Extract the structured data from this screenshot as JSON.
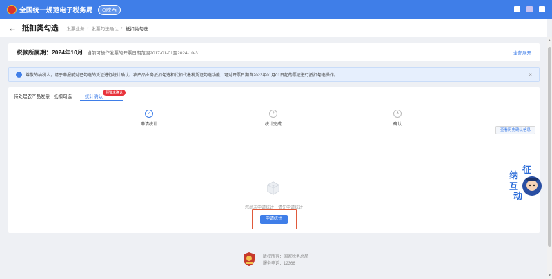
{
  "topbar": {
    "title": "全国统一规范电子税务局",
    "region": "陕西"
  },
  "subheader": {
    "page_title": "抵扣类勾选",
    "breadcrumb": [
      "发票业务",
      "发票勾选确认",
      "抵扣类勾选"
    ]
  },
  "period": {
    "label": "税款所属期：",
    "value": "2024年10月",
    "range_text": "当前可操作发票的开票日期范围2017-01-01至2024-10-31",
    "link": "全部展开"
  },
  "notice": {
    "text": "尊敬的纳税人，请于申报前对已勾选的凭证进行统计确认。农产品业务抵扣勾选和代扣代缴税凭证勾选功能，可对开票日期自2023年01月01日起的票证进行抵扣勾选操作。"
  },
  "tabs": [
    {
      "label": "待处理农产品发票"
    },
    {
      "label": "抵扣勾选"
    },
    {
      "label": "统计确认"
    }
  ],
  "tab_badge": "预警未确认",
  "steps": [
    {
      "num": "✓",
      "label": "申请统计"
    },
    {
      "num": "2",
      "label": "统计完成"
    },
    {
      "num": "3",
      "label": "确认"
    }
  ],
  "history_button": "查看历史确认信息",
  "empty_state": {
    "text": "您尚未申请统计，请先申请统计"
  },
  "apply_button": "申请统计",
  "footer": {
    "owner": "版权所有：国家税务总局",
    "phone": "服务电话：12366"
  },
  "assistant_chars": [
    "征",
    "纳",
    "互",
    "动"
  ],
  "colors": {
    "primary": "#3f7ee8",
    "badge": "#e8333b",
    "highlight": "#e05a3b"
  }
}
